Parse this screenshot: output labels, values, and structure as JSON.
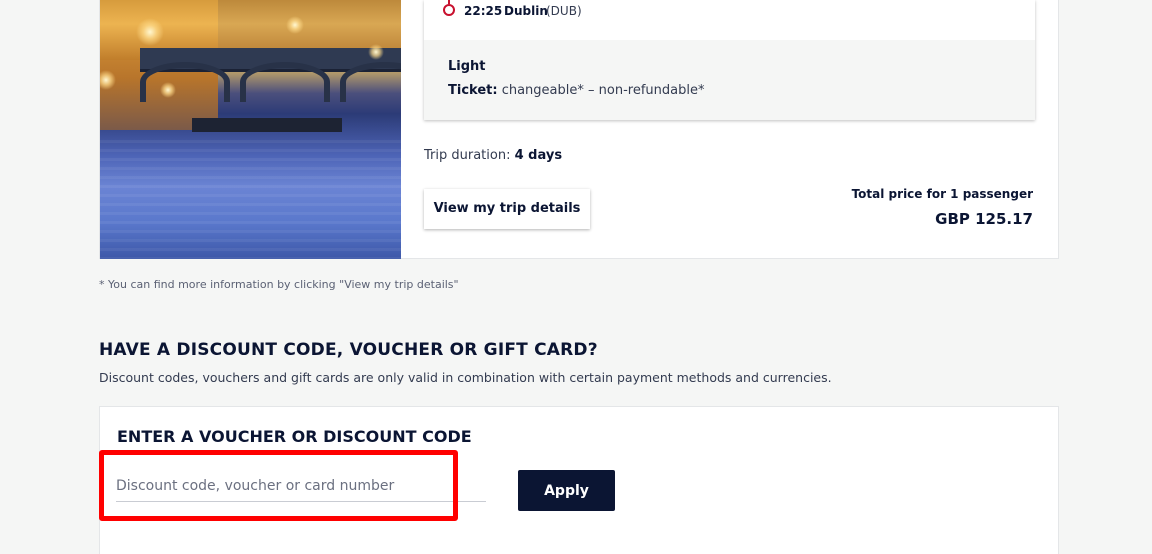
{
  "itinerary": {
    "arrival_time": "22:25",
    "arrival_city": "Dublin",
    "arrival_code": "(DUB)",
    "fare_name": "Light",
    "ticket_label": "Ticket:",
    "ticket_terms": "changeable* – non-refundable*"
  },
  "trip": {
    "duration_label": "Trip duration:",
    "duration_value": "4 days",
    "details_button": "View my trip details",
    "total_label": "Total price for 1 passenger",
    "total_price": "GBP 125.17"
  },
  "footnote": "* You can find more information by clicking \"View my trip details\"",
  "discount": {
    "heading": "HAVE A DISCOUNT CODE, VOUCHER OR GIFT CARD?",
    "description": "Discount codes, vouchers and gift cards are only valid in combination with certain payment methods and currencies.",
    "card_title": "ENTER A VOUCHER OR DISCOUNT CODE",
    "input_placeholder": "Discount code, voucher or card number",
    "input_value": "",
    "apply_label": "Apply"
  },
  "colors": {
    "brand_navy": "#0b1533",
    "accent_red": "#c8102e",
    "highlight": "#ff0000"
  }
}
